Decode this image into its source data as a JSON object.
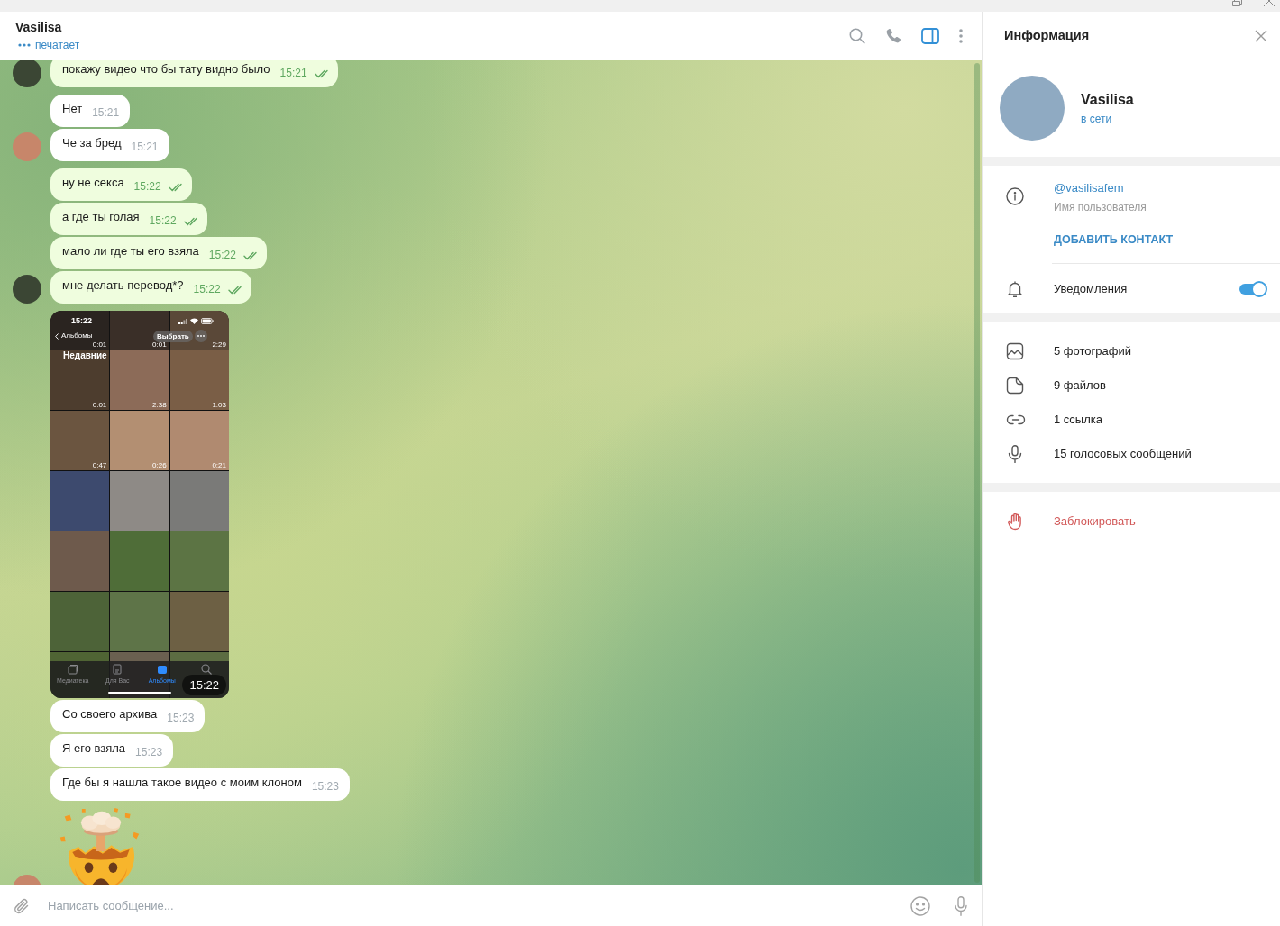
{
  "chat": {
    "name": "Vasilisa",
    "status": "печатает"
  },
  "header_buttons": [
    {
      "kind": "search",
      "on": false
    },
    {
      "kind": "call",
      "on": false
    },
    {
      "kind": "panel",
      "on": true
    },
    {
      "kind": "more",
      "on": false
    }
  ],
  "messages": [
    {
      "kind": "text",
      "outgoing": true,
      "read": true,
      "avatar": true,
      "text": "покажу видео что бы тату видно было",
      "time": "15:21"
    },
    {
      "kind": "text",
      "outgoing": false,
      "avatar": false,
      "text": "Нет",
      "time": "15:21"
    },
    {
      "kind": "text",
      "outgoing": false,
      "avatar": true,
      "text": "Че за бред",
      "time": "15:21"
    },
    {
      "kind": "text",
      "outgoing": true,
      "read": true,
      "avatar": false,
      "text": "ну не секса",
      "time": "15:22"
    },
    {
      "kind": "text",
      "outgoing": true,
      "read": true,
      "avatar": false,
      "text": "а где ты голая",
      "time": "15:22"
    },
    {
      "kind": "text",
      "outgoing": true,
      "read": true,
      "avatar": false,
      "text": "мало ли где ты его взяла",
      "time": "15:22"
    },
    {
      "kind": "text",
      "outgoing": true,
      "read": true,
      "avatar": true,
      "text": "мне делать перевод*?",
      "time": "15:22"
    },
    {
      "kind": "screenshot",
      "outgoing": false,
      "avatar": false,
      "time": "15:22",
      "screen": {
        "status_time": "15:22",
        "back_label": "Альбомы",
        "select_label": "Выбрать",
        "title": "Недавние",
        "tiles": [
          {
            "kind": "video",
            "duration": "0:01"
          },
          {
            "kind": "video",
            "duration": "0:01"
          },
          {
            "kind": "video",
            "duration": "2:29"
          },
          {
            "kind": "video",
            "duration": "0:01"
          },
          {
            "kind": "video",
            "duration": "2:38"
          },
          {
            "kind": "video",
            "duration": "1:03"
          },
          {
            "kind": "video",
            "duration": "0:47"
          },
          {
            "kind": "video",
            "duration": "0:26"
          },
          {
            "kind": "video",
            "duration": "0:21"
          },
          {
            "kind": "photo"
          },
          {
            "kind": "photo"
          },
          {
            "kind": "photo"
          },
          {
            "kind": "photo"
          },
          {
            "kind": "photo"
          },
          {
            "kind": "photo"
          },
          {
            "kind": "photo"
          },
          {
            "kind": "photo"
          },
          {
            "kind": "photo"
          },
          {
            "kind": "photo"
          },
          {
            "kind": "photo"
          },
          {
            "kind": "photo"
          }
        ],
        "tabs": [
          {
            "kind": "library",
            "label": "Медиатека",
            "selected": false
          },
          {
            "kind": "for_you",
            "label": "Для Вас",
            "selected": false
          },
          {
            "kind": "albums",
            "label": "Альбомы",
            "selected": true
          },
          {
            "kind": "search",
            "selected": false
          }
        ]
      }
    },
    {
      "kind": "text",
      "outgoing": false,
      "avatar": false,
      "text": "Со своего архива",
      "time": "15:23"
    },
    {
      "kind": "text",
      "outgoing": false,
      "avatar": false,
      "text": "Я его взяла",
      "time": "15:23"
    },
    {
      "kind": "text",
      "outgoing": false,
      "avatar": false,
      "text": "Где бы я нашла такое видео с моим клоном",
      "time": "15:23"
    },
    {
      "kind": "sticker",
      "outgoing": false,
      "avatar": true
    }
  ],
  "composer": {
    "placeholder": "Написать сообщение..."
  },
  "info_panel": {
    "title": "Информация",
    "name": "Vasilisa",
    "status": "в сети",
    "username": "@vasilisafem",
    "username_caption": "Имя пользователя",
    "add_contact": "ДОБАВИТЬ КОНТАКТ",
    "notifications": {
      "label": "Уведомления",
      "on": true
    },
    "media": [
      {
        "kind": "photos",
        "label": "5 фотографий"
      },
      {
        "kind": "files",
        "label": "9 файлов"
      },
      {
        "kind": "links",
        "label": "1 ссылка"
      },
      {
        "kind": "voice",
        "label": "15 голосовых сообщений"
      }
    ],
    "block": "Заблокировать"
  }
}
